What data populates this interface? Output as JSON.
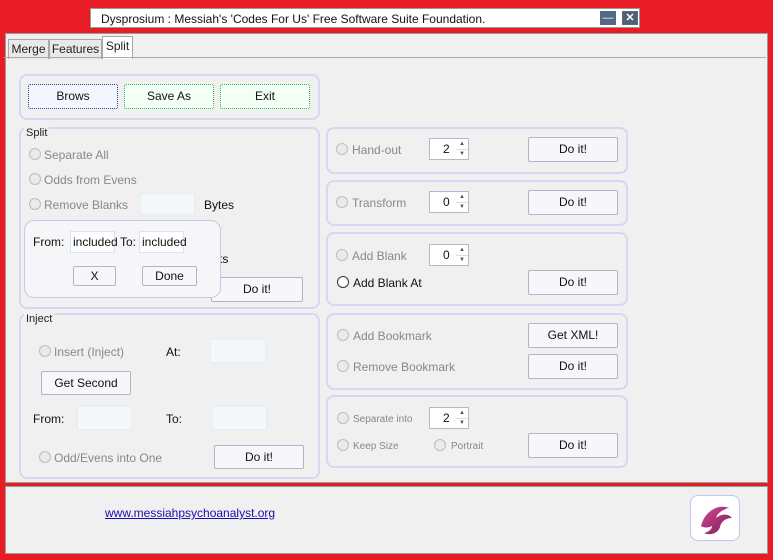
{
  "window": {
    "title": "Dysprosium : Messiah's 'Codes For Us' Free Software Suite Foundation.",
    "minimize": "—",
    "close": "✕"
  },
  "tabs": [
    {
      "label": "Merge"
    },
    {
      "label": "Features"
    },
    {
      "label": "Split"
    }
  ],
  "toolbar": {
    "browse": "Brows",
    "save_as": "Save As",
    "exit": "Exit"
  },
  "split": {
    "title": "Split",
    "separate_all": "Separate All",
    "odds_from_evens": "Odds from Evens",
    "remove_blanks": "Remove Blanks",
    "bytes": "Bytes",
    "behind_popup_text": "ts",
    "do_it": "Do it!"
  },
  "range_popup": {
    "from_label": "From:",
    "from_value": "included",
    "to_label": "To:",
    "to_value": "included",
    "cancel": "X",
    "done": "Done"
  },
  "inject": {
    "title": "Inject",
    "insert": "Insert (Inject)",
    "at": "At:",
    "get_second": "Get Second",
    "from": "From:",
    "to": "To:",
    "odd_evens": "Odd/Evens into One",
    "do_it": "Do it!"
  },
  "handout": {
    "label": "Hand-out",
    "value": "2",
    "do_it": "Do it!"
  },
  "transform": {
    "label": "Transform",
    "value": "0",
    "do_it": "Do it!"
  },
  "blank": {
    "add_blank": "Add Blank",
    "value": "0",
    "add_blank_at": "Add Blank At",
    "do_it": "Do it!"
  },
  "bookmark": {
    "add": "Add Bookmark",
    "remove": "Remove Bookmark",
    "get_xml": "Get XML!",
    "do_it": "Do it!"
  },
  "separate": {
    "label": "Separate into",
    "value": "2",
    "keep_size": "Keep Size",
    "portrait": "Portrait",
    "do_it": "Do it!"
  },
  "footer": {
    "link": "www.messiahpsychoanalyst.org"
  },
  "icons": {
    "logo": "phoenix-logo-icon"
  }
}
